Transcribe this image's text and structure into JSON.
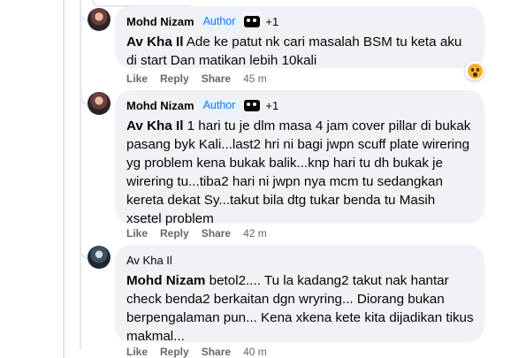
{
  "comments": [
    {
      "author": "Mohd Nizam",
      "author_badge": "Author",
      "badge_count": "+1",
      "mention": "Av Kha Il",
      "text": " Ade ke patut nk cari masalah BSM tu keta aku di start Dan matikan lebih 10kali",
      "actions": {
        "like": "Like",
        "reply": "Reply",
        "share": "Share",
        "time": "45 m"
      }
    },
    {
      "author": "Mohd Nizam",
      "author_badge": "Author",
      "badge_count": "+1",
      "mention": "Av Kha Il",
      "text": " 1 hari tu je dlm masa 4 jam cover pillar di bukak pasang byk Kali...last2 hri ni bagi jwpn scuff plate wirering yg problem kena bukak balik...knp hari tu dh bukak je wirering tu...tiba2 hari ni jwpn nya mcm tu sedangkan kereta dekat Sy...takut bila dtg tukar benda tu Masih xsetel problem",
      "actions": {
        "like": "Like",
        "reply": "Reply",
        "share": "Share",
        "time": "42 m"
      }
    },
    {
      "author": "Av Kha Il",
      "mention": "Mohd Nizam",
      "text": " betol2.... Tu la kadang2 takut nak hantar check benda2 berkaitan dgn wryring... Diorang bukan berpengalaman pun... Kena xkena kete kita dijadikan tikus makmal...",
      "actions": {
        "like": "Like",
        "reply": "Reply",
        "share": "Share",
        "time": "40 m"
      }
    }
  ],
  "reaction": {
    "icon": "wow-emoji-icon"
  }
}
